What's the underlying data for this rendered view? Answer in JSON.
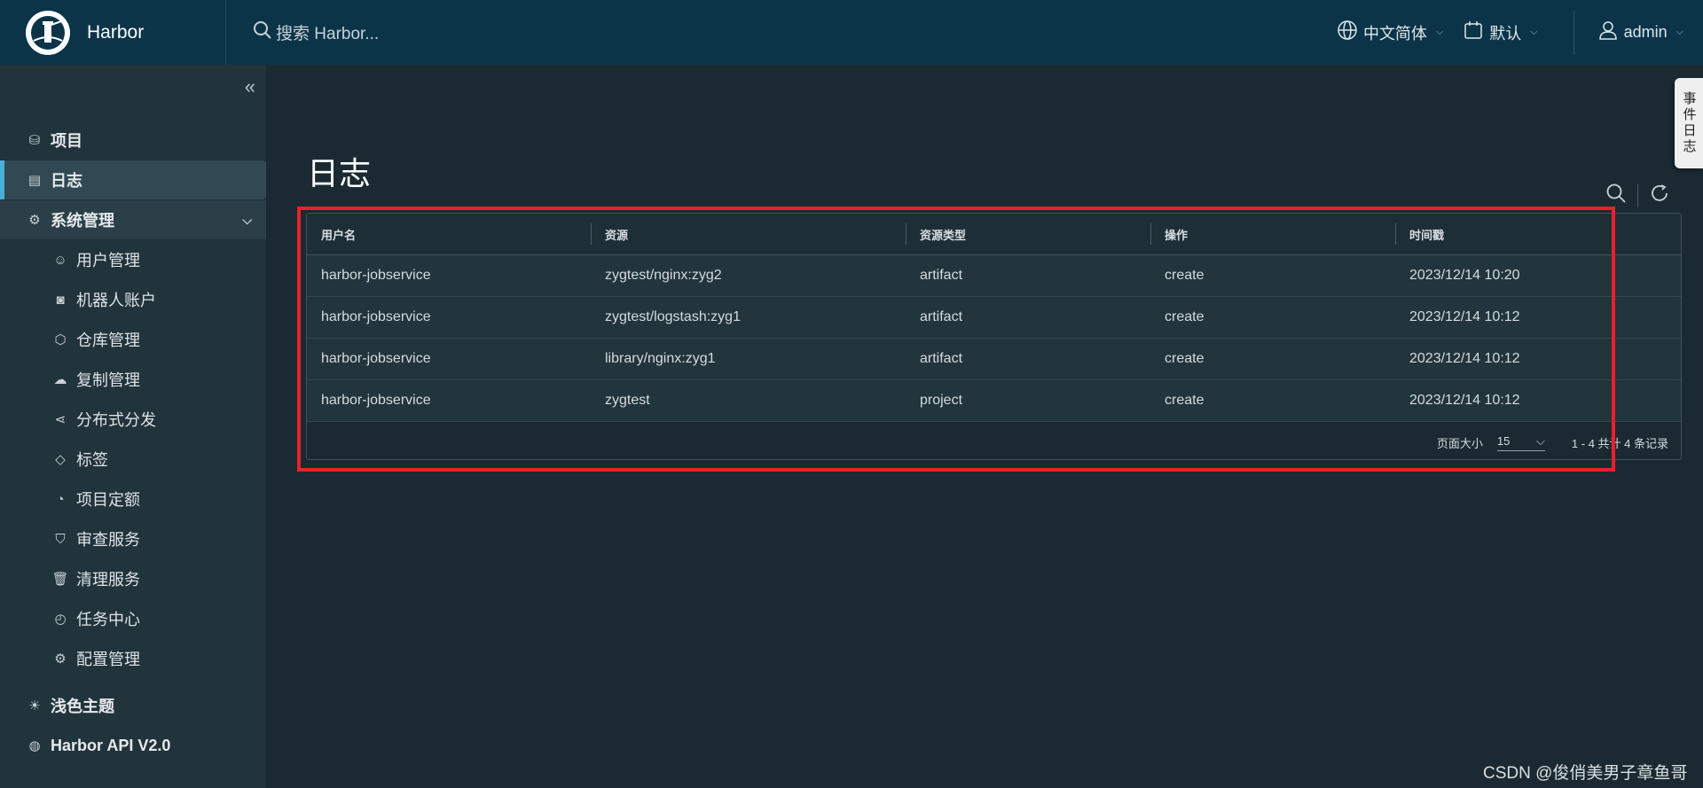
{
  "header": {
    "title": "Harbor",
    "search_placeholder": "搜索 Harbor...",
    "language": "中文简体",
    "theme_menu": "默认",
    "user": "admin"
  },
  "sidebar": {
    "items": [
      {
        "label": "项目",
        "icon": "project-icon"
      },
      {
        "label": "日志",
        "icon": "log-icon",
        "active": true
      },
      {
        "label": "系统管理",
        "icon": "system-admin-icon",
        "expanded": true
      }
    ],
    "sub_items": [
      {
        "label": "用户管理",
        "icon": "users-icon"
      },
      {
        "label": "机器人账户",
        "icon": "robot-icon"
      },
      {
        "label": "仓库管理",
        "icon": "registry-icon"
      },
      {
        "label": "复制管理",
        "icon": "replication-icon"
      },
      {
        "label": "分布式分发",
        "icon": "share-icon"
      },
      {
        "label": "标签",
        "icon": "tag-icon"
      },
      {
        "label": "项目定额",
        "icon": "quota-icon"
      },
      {
        "label": "审查服务",
        "icon": "shield-icon"
      },
      {
        "label": "清理服务",
        "icon": "trash-icon"
      },
      {
        "label": "任务中心",
        "icon": "dashboard-icon"
      },
      {
        "label": "配置管理",
        "icon": "gear-icon"
      }
    ],
    "footer": [
      {
        "label": "浅色主题",
        "icon": "sun-icon"
      },
      {
        "label": "Harbor API V2.0",
        "icon": "api-icon"
      }
    ]
  },
  "main": {
    "title": "日志",
    "columns": [
      "用户名",
      "资源",
      "资源类型",
      "操作",
      "时间戳"
    ],
    "rows": [
      [
        "harbor-jobservice",
        "zygtest/nginx:zyg2",
        "artifact",
        "create",
        "2023/12/14 10:20"
      ],
      [
        "harbor-jobservice",
        "zygtest/logstash:zyg1",
        "artifact",
        "create",
        "2023/12/14 10:12"
      ],
      [
        "harbor-jobservice",
        "library/nginx:zyg1",
        "artifact",
        "create",
        "2023/12/14 10:12"
      ],
      [
        "harbor-jobservice",
        "zygtest",
        "project",
        "create",
        "2023/12/14 10:12"
      ]
    ],
    "page_size_label": "页面大小",
    "page_size": "15",
    "record_count": "1 - 4 共计 4 条记录"
  },
  "side_tab": "事件日志",
  "watermark": "CSDN @俊俏美男子章鱼哥",
  "colors": {
    "header_bg": "#0b3449",
    "sidebar_bg": "#21333b",
    "main_bg": "#1b2a32",
    "active_accent": "#49afd9",
    "highlight_border": "#e8212b"
  }
}
